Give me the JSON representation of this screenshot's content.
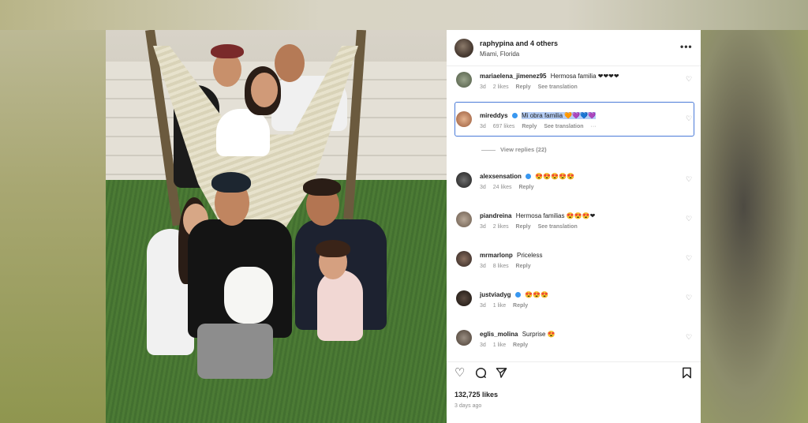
{
  "post": {
    "poster_user": "raphypina and 4 others",
    "location": "Miami, Florida",
    "more_label": "•••",
    "likes": "132,725 likes",
    "posted": "3 days ago"
  },
  "comments": [
    {
      "user": "mariaelena_jimenez95",
      "verified": false,
      "text": "Hermosa familia ❤❤❤❤",
      "time": "3d",
      "likes": "2 likes",
      "reply": "Reply",
      "translate": "See translation"
    },
    {
      "user": "mireddys",
      "verified": true,
      "text": "Mi obra familia 🧡💜💙💜",
      "time": "3d",
      "likes": "697 likes",
      "reply": "Reply",
      "translate": "See translation",
      "extra": "···"
    },
    {
      "user": "alexsensation",
      "verified": true,
      "text": "😍😍😍😍😍",
      "time": "3d",
      "likes": "24 likes",
      "reply": "Reply"
    },
    {
      "user": "piandreina",
      "verified": false,
      "text": "Hermosa familias 😍😍😍❤",
      "time": "3d",
      "likes": "2 likes",
      "reply": "Reply",
      "translate": "See translation"
    },
    {
      "user": "mrmarlonp",
      "verified": false,
      "text": "Priceless",
      "time": "3d",
      "likes": "8 likes",
      "reply": "Reply"
    },
    {
      "user": "justviadyg",
      "verified": true,
      "text": "😍😍😍",
      "time": "3d",
      "likes": "1 like",
      "reply": "Reply"
    },
    {
      "user": "eglis_molina",
      "verified": false,
      "text": "Surprise 😍",
      "time": "3d",
      "likes": "1 like",
      "reply": "Reply"
    }
  ],
  "view_replies": "View replies (22)",
  "icons": {
    "like": "heart-icon",
    "comment": "comment-icon",
    "share": "share-icon",
    "save": "bookmark-icon"
  },
  "colors": {
    "selection_border": "#4a7bd8",
    "selection_fill": "#b5cdf5",
    "verified": "#3897f0"
  }
}
